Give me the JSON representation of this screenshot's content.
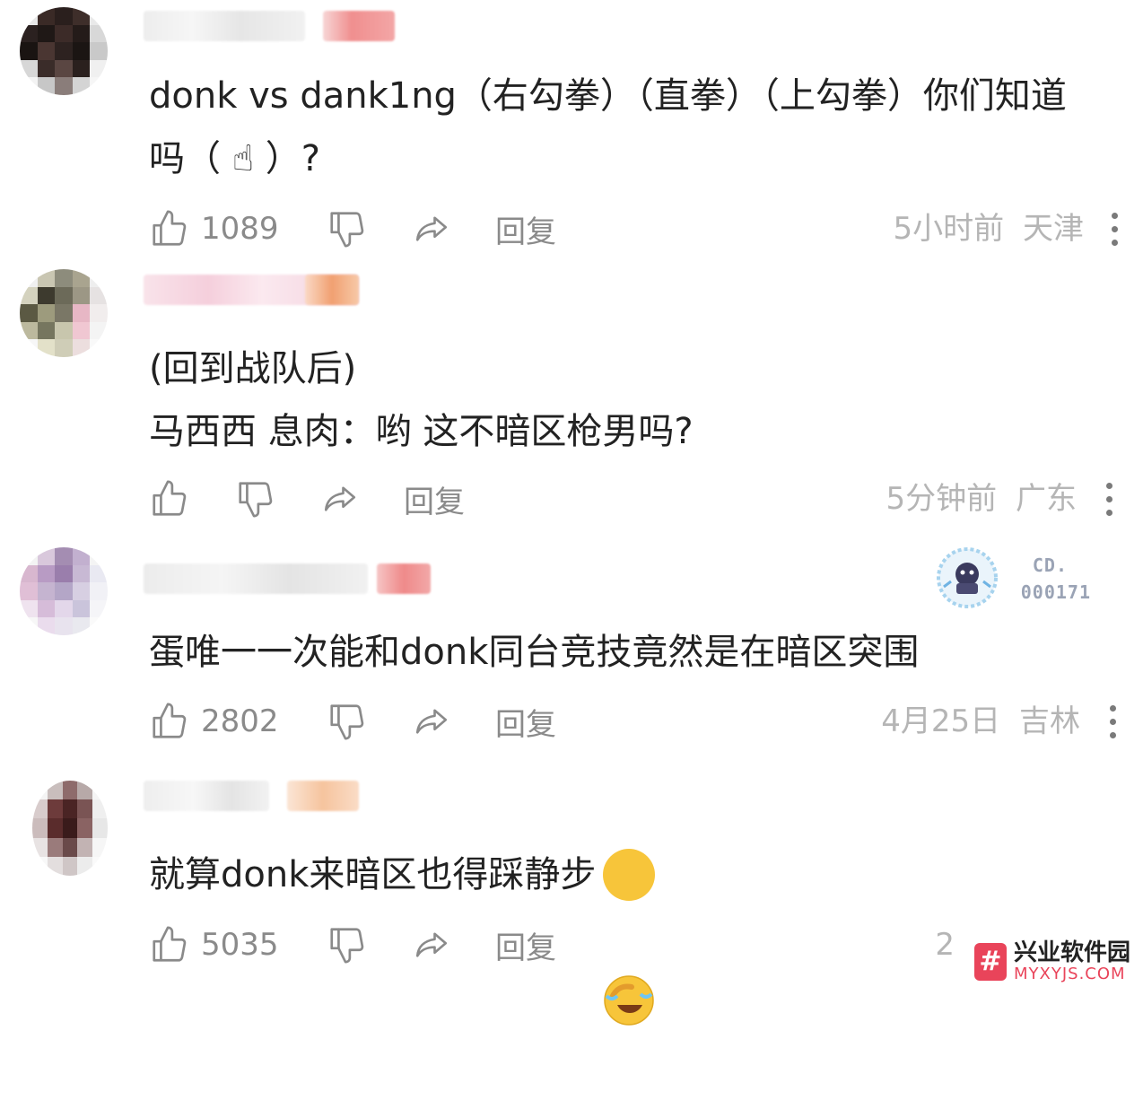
{
  "comments": [
    {
      "text": "donk vs dank1ng（右勾拳）（直拳）（上勾拳）你们知道\n吗（ ☝ ）?",
      "likes": "1089",
      "time": "5小时前",
      "location": "天津",
      "reply": "回复"
    },
    {
      "text": "(回到战队后)\n马西西 息肉：哟 这不暗区枪男吗?",
      "likes": "",
      "time": "5分钟前",
      "location": "广东",
      "reply": "回复"
    },
    {
      "text": "蛋唯一一次能和donk同台竞技竟然是在暗区突围",
      "likes": "2802",
      "time": "4月25日",
      "location": "吉林",
      "reply": "回复",
      "medal_lines": [
        "CD.",
        "000171"
      ]
    },
    {
      "text": "就算donk来暗区也得踩静步",
      "likes": "5035",
      "time": "2",
      "location": "",
      "reply": "回复"
    }
  ],
  "watermark": {
    "title": "兴业软件园",
    "url": "MYXYJS.COM",
    "logo": "#"
  },
  "icons": {
    "like": "thumbs-up-icon",
    "dislike": "thumbs-down-icon",
    "share": "share-arrow-icon",
    "more": "more-vertical-icon"
  },
  "colors": {
    "meta": "#b5b5b5",
    "action": "#8a8a8a",
    "watermark": "#e9445a"
  }
}
